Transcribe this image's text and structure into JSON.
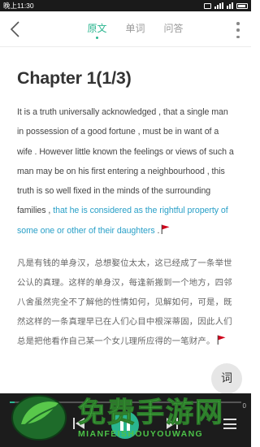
{
  "status_bar": {
    "time": "晚上11:30",
    "battery": "■"
  },
  "top_bar": {
    "tabs": [
      {
        "label": "原文",
        "active": true
      },
      {
        "label": "单词",
        "active": false
      },
      {
        "label": "问答",
        "active": false
      }
    ]
  },
  "reader": {
    "chapter_title": "Chapter 1(1/3)",
    "english_plain": "It is a truth universally acknowledged , that a single man in possession of a good fortune , must be in want of a wife . However little known the feelings or views of such a man may be on his first entering a neighbourhood , this truth is so well fixed in the minds of the surrounding families , ",
    "english_highlight": "that he is considered as the rightful property of some one or other of their daughters",
    "english_tail": " .",
    "chinese": "凡是有钱的单身汉，总想娶位太太，这已经成了一条举世公认的真理。这样的单身汉，每逢新搬到一个地方，四邻八舍虽然完全不了解他的性情如何，见解如何，可是，既然这样的一条真理早已在人们心目中根深蒂固，因此人们总是把他看作自己某一个女儿理所应得的一笔财产。"
  },
  "floating": {
    "word_button": "词"
  },
  "player": {
    "progress_fraction": 0.02,
    "time_right": "0"
  },
  "watermark": {
    "title": "免费手游网",
    "subtitle": "MIANFEISHOUYOUWANG"
  },
  "colors": {
    "accent": "#2ab58f",
    "highlight_text": "#2aa0c8",
    "flag": "#d0021b",
    "watermark_green": "#4cc248"
  }
}
